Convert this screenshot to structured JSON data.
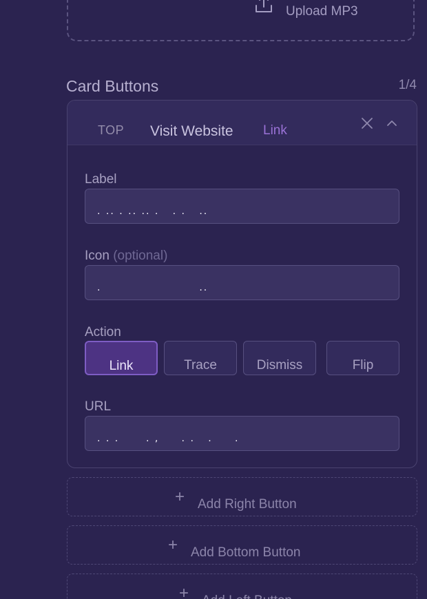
{
  "upload": {
    "label": "Upload MP3",
    "icon": "upload-icon"
  },
  "section": {
    "title": "Card Buttons",
    "count": "1/4"
  },
  "card": {
    "position": "TOP",
    "title": "Visit Website",
    "action_tag": "Link",
    "icons": {
      "close": "close-icon",
      "collapse": "chevron-up-icon"
    },
    "label_field": {
      "label": "Label",
      "value": ". .. . .. .. .   . .   .."
    },
    "icon_field": {
      "label": "Icon",
      "optional": "(optional)",
      "value": ".                      .."
    },
    "action_field": {
      "label": "Action",
      "options": [
        "Link",
        "Trace",
        "Dismiss",
        "Flip"
      ],
      "selected": "Link"
    },
    "url_field": {
      "label": "URL",
      "value": ". . .      . ,     . .   .     ."
    }
  },
  "add_buttons": {
    "right": "Add Right Button",
    "bottom": "Add Bottom Button",
    "left": "Add Left Button"
  },
  "colors": {
    "background": "#2b2350",
    "accent": "#7e5dc4",
    "accent_text": "#9a72d6"
  }
}
